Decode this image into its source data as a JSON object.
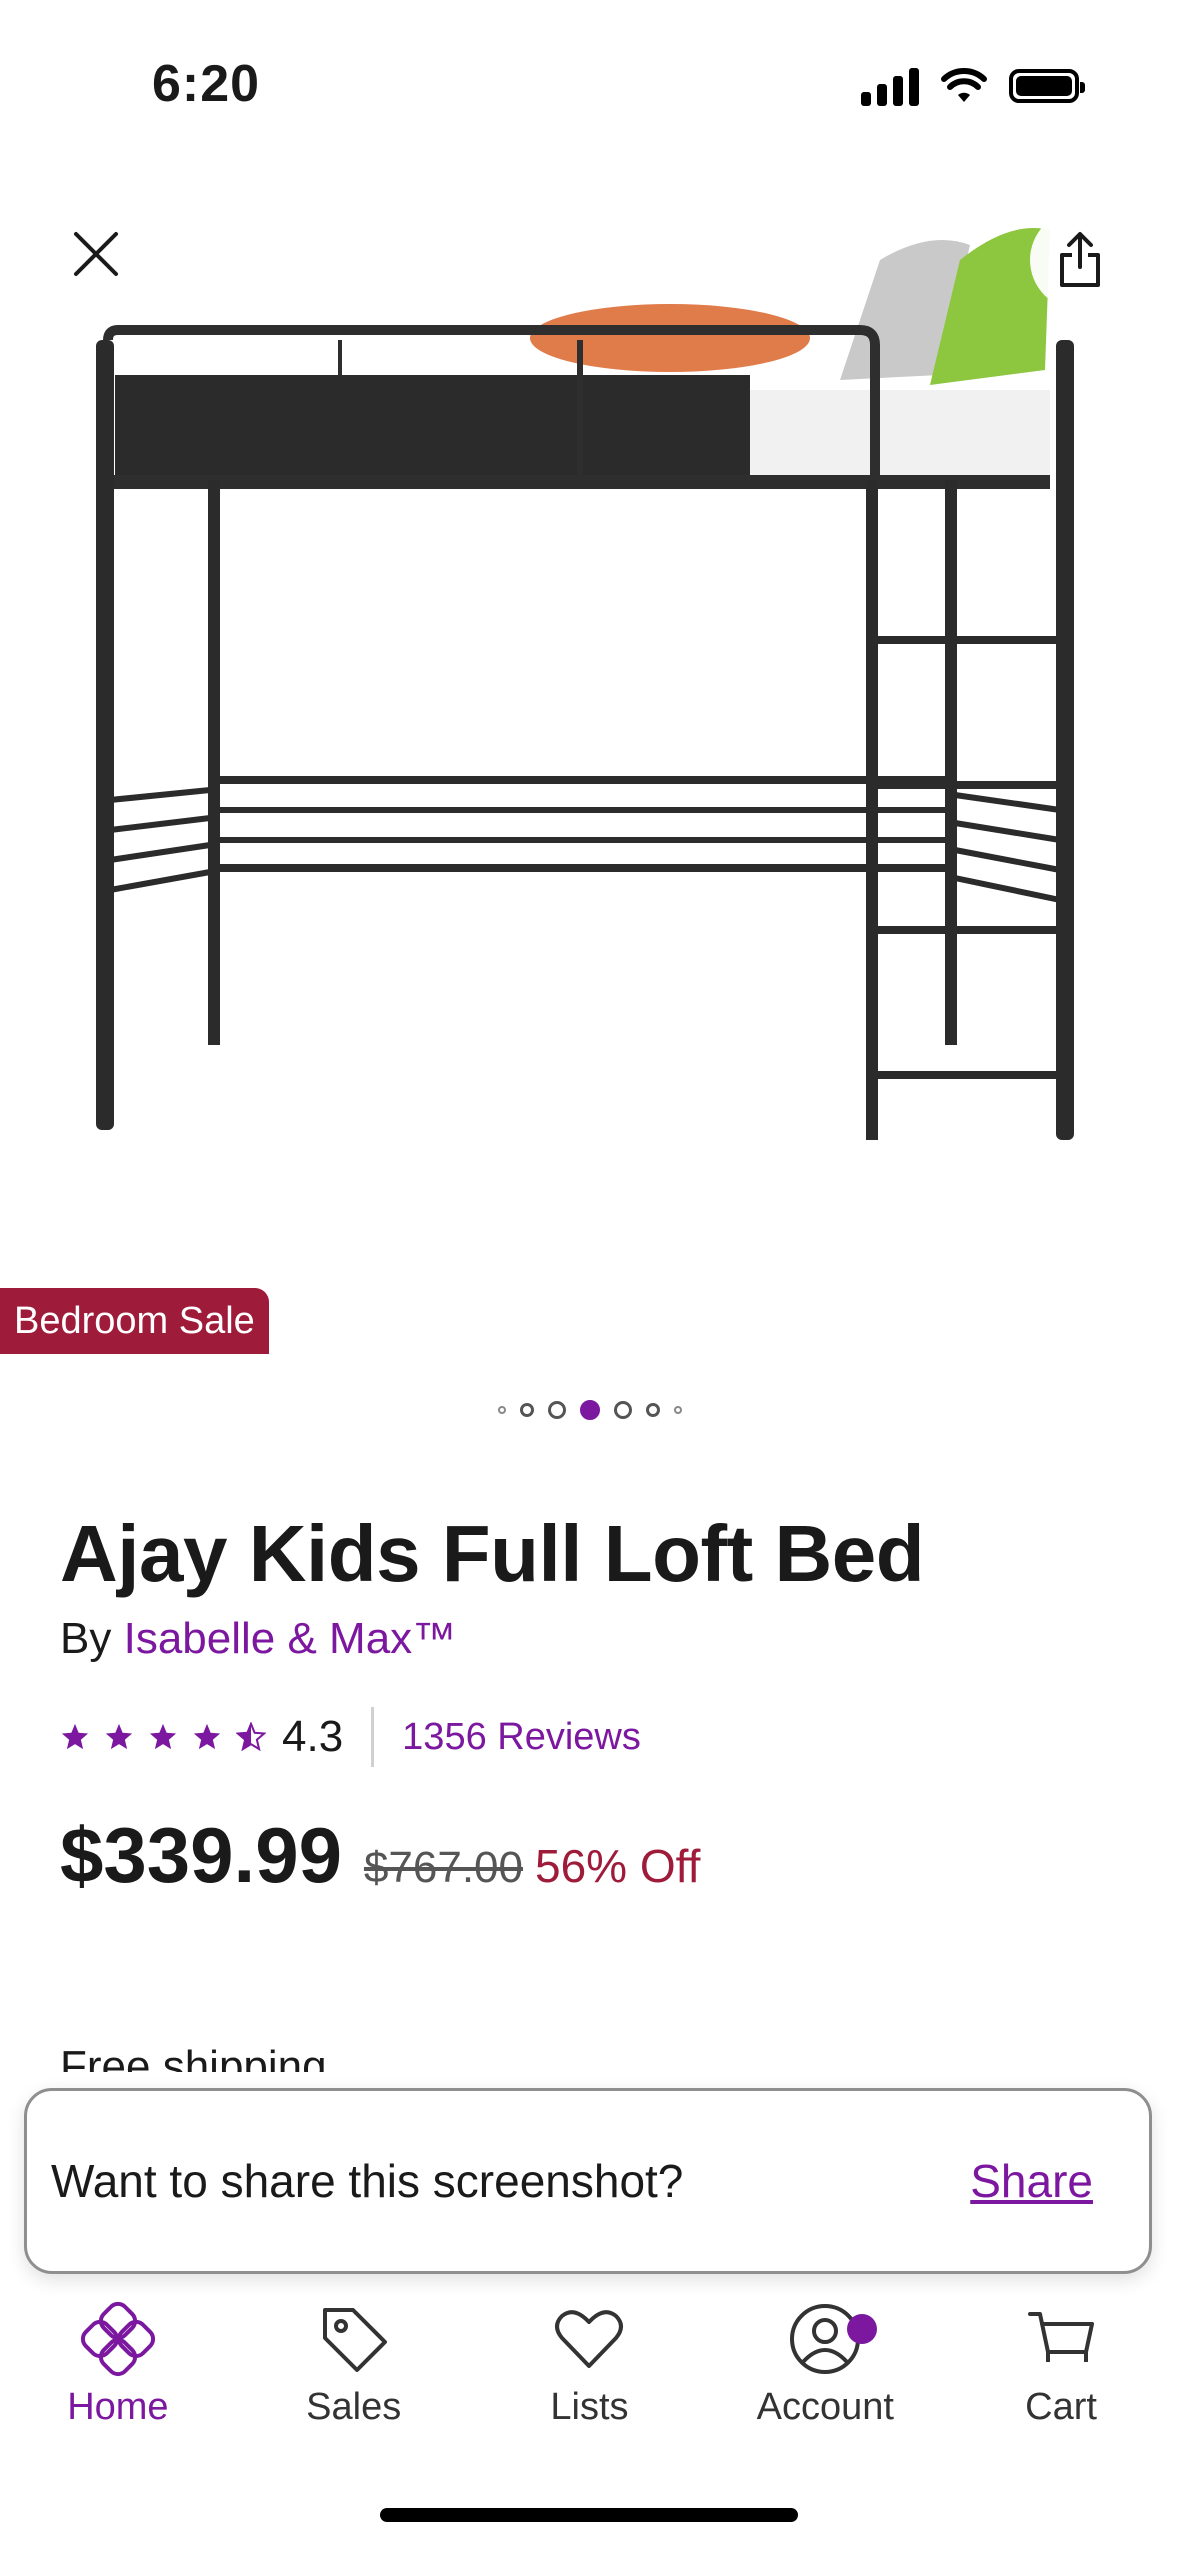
{
  "status_bar": {
    "time": "6:20"
  },
  "hero": {
    "sale_badge": "Bedroom Sale",
    "carousel": {
      "total": 7,
      "active_index": 3
    }
  },
  "product": {
    "title": "Ajay Kids Full Loft Bed",
    "by_label": "By",
    "brand": "Isabelle & Max™",
    "rating": "4.3",
    "rating_stars": 4.5,
    "reviews": "1356 Reviews",
    "price": "$339.99",
    "original_price": "$767.00",
    "discount": "56% Off",
    "shipping": "Free shipping"
  },
  "share_prompt": {
    "text": "Want to share this screenshot?",
    "action": "Share"
  },
  "bottom_nav": {
    "items": [
      {
        "label": "Home",
        "icon": "home-icon",
        "active": true
      },
      {
        "label": "Sales",
        "icon": "tag-icon",
        "active": false
      },
      {
        "label": "Lists",
        "icon": "heart-icon",
        "active": false
      },
      {
        "label": "Account",
        "icon": "account-icon",
        "active": false,
        "badge": true
      },
      {
        "label": "Cart",
        "icon": "cart-icon",
        "active": false
      }
    ]
  },
  "colors": {
    "accent": "#7b189f",
    "sale": "#9e1b3a"
  }
}
